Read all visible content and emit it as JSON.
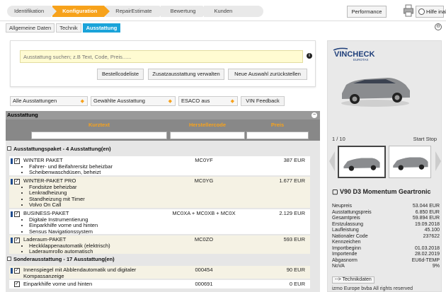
{
  "process": {
    "steps": [
      "Identifikation",
      "Konfiguration",
      "RepairEstimate",
      "Bewertung",
      "Kunden"
    ],
    "active": "Konfiguration",
    "performance_label": "Performance",
    "help_label": "Hilfe inaktiv"
  },
  "subtabs": [
    "Allgemeine Daten",
    "Technik",
    "Ausstattung"
  ],
  "search": {
    "placeholder": "Ausstattung suchen; z.B Text, Code, Preis......",
    "buttons": [
      "Bestellcodeliste",
      "Zusatzausstattung verwalten",
      "Neue Auswahl zurückstellen"
    ]
  },
  "filters": {
    "all": "Alle Ausstattungen",
    "selected": "Gewählte Ausstattung",
    "esaco": "ESACO aus",
    "vin_feedback": "VIN Feedback"
  },
  "table": {
    "title": "Ausstattung",
    "columns": [
      "Kurztext",
      "Herstellercode",
      "Preis"
    ],
    "groups": [
      {
        "label": "Ausstattungspaket - 4 Ausstattung(en)",
        "rows": [
          {
            "name": "WINTER PAKET",
            "items": [
              "Fahrer- und Beifahrersitz beheizbar",
              "Scheibenwaschdüsen, beheizt"
            ],
            "code": "MC0YF",
            "price": "387 EUR"
          },
          {
            "name": "WINTER-PAKET PRO",
            "items": [
              "Fondsitze beheizbar",
              "Lenkradheizung",
              "Standheizung mit Timer",
              "Volvo On Call"
            ],
            "code": "MC0YG",
            "price": "1.677 EUR"
          },
          {
            "name": "BUSINESS-PAKET",
            "items": [
              "Digitale Instrumentierung",
              "Einparkhilfe vorne und hinten",
              "Sensus Navigationssystem"
            ],
            "code": "MC0XA + MC0XB + MC0X",
            "price": "2.129 EUR"
          },
          {
            "name": "Laderaum-PAKET",
            "items": [
              "Heckklappenautomatik (elektrisch)",
              "Laderaumrollo automatisch"
            ],
            "code": "MC0ZO",
            "price": "593 EUR"
          }
        ]
      },
      {
        "label": "Sonderausstattung - 17 Ausstattung(en)",
        "rows": [
          {
            "name": "Innenspiegel mit Abblendautomatik und digitaler Kompassanzeige",
            "items": [],
            "code": "000454",
            "price": "90 EUR"
          },
          {
            "name": "Einparkhilfe vorne und hinten",
            "items": [],
            "code": "000691",
            "price": "0 EUR"
          }
        ]
      }
    ]
  },
  "vehicle": {
    "logo": "VINCHECK",
    "logo_sub": "EUROTAX",
    "counter": "1 / 10",
    "start_stop": "Start  Stop",
    "model": "V90 D3 Momentum Geartronic",
    "specs": [
      {
        "label": "Neupreis",
        "value": "53.044 EUR"
      },
      {
        "label": "Ausstattungspreis",
        "value": "6.850 EUR"
      },
      {
        "label": "Gesamtpreis",
        "value": "59.894 EUR"
      },
      {
        "label": "Erstzulassung",
        "value": "19.09.2018"
      },
      {
        "label": "Laufleistung",
        "value": "45.100"
      },
      {
        "label": "Nationaler Code",
        "value": "237622"
      },
      {
        "label": "Kennzeichen",
        "value": ""
      },
      {
        "label": "Importbeginn",
        "value": "01.03.2018"
      },
      {
        "label": "Importende",
        "value": "28.02.2019"
      },
      {
        "label": "Abgasnorm",
        "value": "EU6d-TEMP"
      },
      {
        "label": "NoVA",
        "value": "9%"
      }
    ],
    "tech_button": "--> Technikdaten",
    "copyright": "izmo Europe bvba All rights reserved"
  },
  "colors": {
    "accent": "#f7a21b",
    "tab_active": "#1aa3d9",
    "indicator": "#1f4c8f"
  }
}
